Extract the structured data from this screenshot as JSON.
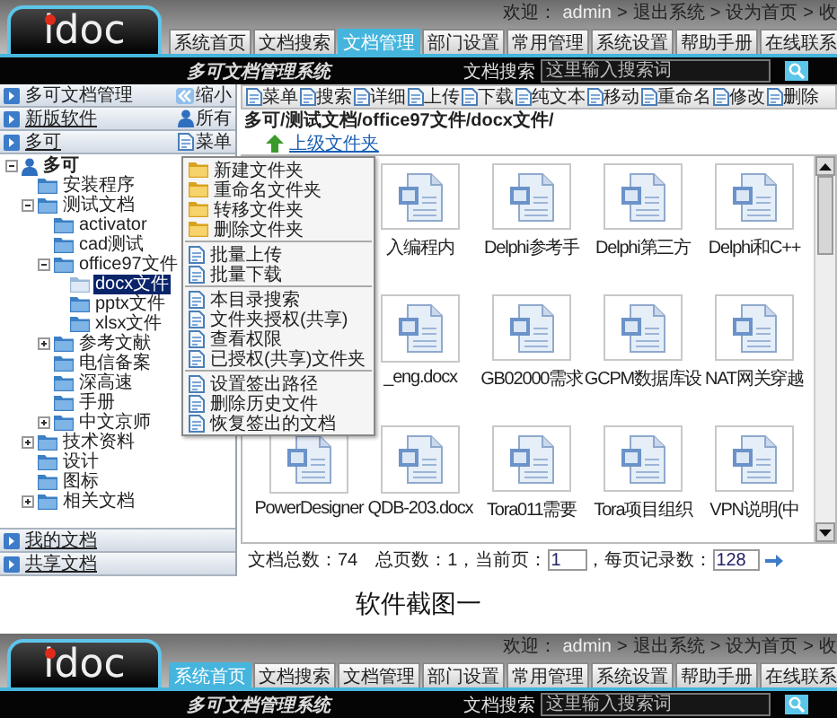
{
  "screenshot_1": {
    "header": {
      "logo": "idoc",
      "welcome": "欢迎：",
      "user": "admin",
      "links": [
        {
          "separator": ">",
          "label": "退出系统"
        },
        {
          "separator": ">",
          "label": "设为首页"
        },
        {
          "separator": ">",
          "label": "收"
        }
      ],
      "tabs": [
        {
          "label": "系统首页",
          "selected": false
        },
        {
          "label": "文档搜索",
          "selected": false
        },
        {
          "label": "文档管理",
          "selected": true
        },
        {
          "label": "部门设置",
          "selected": false
        },
        {
          "label": "常用管理",
          "selected": false
        },
        {
          "label": "系统设置",
          "selected": false
        },
        {
          "label": "帮助手册",
          "selected": false
        },
        {
          "label": "在线联系",
          "selected": false
        }
      ],
      "subtitle": "多可文档管理系统",
      "search": {
        "label": "文档搜索",
        "placeholder": "这里输入搜索词"
      }
    },
    "sidebar": {
      "panels": [
        {
          "label": "多可文档管理",
          "link": false,
          "button": "缩小"
        },
        {
          "label": "新版软件",
          "link": true,
          "button": "所有"
        },
        {
          "label": "多可",
          "link": true,
          "button": "菜单"
        }
      ],
      "tree": [
        {
          "label": "多可",
          "selected": false,
          "expanded": true,
          "children": [
            {
              "label": "安装程序",
              "selected": false
            },
            {
              "label": "测试文档",
              "selected": false,
              "expanded": true,
              "children": [
                {
                  "label": "activator",
                  "selected": false
                },
                {
                  "label": "cad测试",
                  "selected": false
                },
                {
                  "label": "office97文件",
                  "selected": false,
                  "expanded": true,
                  "children": [
                    {
                      "label": "docx文件",
                      "selected": true
                    },
                    {
                      "label": "pptx文件",
                      "selected": false
                    },
                    {
                      "label": "xlsx文件",
                      "selected": false
                    }
                  ]
                },
                {
                  "label": "参考文献",
                  "selected": false,
                  "expanded": false
                },
                {
                  "label": "电信备案",
                  "selected": false
                },
                {
                  "label": "深高速",
                  "selected": false
                },
                {
                  "label": "手册",
                  "selected": false
                },
                {
                  "label": "中文京师",
                  "selected": false,
                  "expanded": false
                }
              ]
            },
            {
              "label": "技术资料",
              "selected": false,
              "expanded": false
            },
            {
              "label": "设计",
              "selected": false
            },
            {
              "label": "图标",
              "selected": false
            },
            {
              "label": "相关文档",
              "selected": false,
              "expanded": false
            }
          ]
        }
      ],
      "bottom_panels": [
        {
          "label": "我的文档",
          "link": true
        },
        {
          "label": "共享文档",
          "link": true
        }
      ]
    },
    "menu": {
      "groups": [
        [
          "新建文件夹",
          "重命名文件夹",
          "转移文件夹",
          "删除文件夹"
        ],
        [
          "批量上传",
          "批量下载"
        ],
        [
          "本目录搜索",
          "文件夹授权(共享)",
          "查看权限",
          "已授权(共享)文件夹"
        ],
        [
          "设置签出路径",
          "删除历史文件",
          "恢复签出的文档"
        ]
      ]
    },
    "explorer": {
      "toolbar": [
        "菜单",
        "搜索",
        "详细",
        "上传",
        "下载",
        "纯文本",
        "移动",
        "重命名",
        "修改",
        "删除"
      ],
      "path": "多可/测试文档/office97文件/docx文件/",
      "up_link": "上级文件夹",
      "file_rows": [
        [
          "入编程内",
          "Delphi参考手",
          "Delphi第三方",
          "Delphi和C++"
        ],
        [
          "_eng.docx",
          "GB02000需求",
          "GCPM数据库设",
          "NAT网关穿越"
        ],
        [
          "PowerDesigner",
          "QDB-203.docx",
          "Tora011需要",
          "Tora项目组织",
          "VPN说明(中"
        ]
      ],
      "footer": {
        "total": "文档总数：74",
        "pages": "总页数：1，",
        "page_label": "当前页：",
        "page": "1",
        "per_page_label": "，每页记录数：",
        "per_page": "128"
      }
    }
  },
  "caption": "软件截图一",
  "screenshot_2": {
    "header": {
      "logo": "idoc",
      "welcome": "欢迎：",
      "user": "admin",
      "links": [
        {
          "separator": ">",
          "label": "退出系统"
        },
        {
          "separator": ">",
          "label": "设为首页"
        },
        {
          "separator": ">",
          "label": "收"
        }
      ],
      "tabs": [
        {
          "label": "系统首页",
          "selected": true
        },
        {
          "label": "文档搜索",
          "selected": false
        },
        {
          "label": "文档管理",
          "selected": false
        },
        {
          "label": "部门设置",
          "selected": false
        },
        {
          "label": "常用管理",
          "selected": false
        },
        {
          "label": "系统设置",
          "selected": false
        },
        {
          "label": "帮助手册",
          "selected": false
        },
        {
          "label": "在线联系",
          "selected": false
        }
      ],
      "subtitle": "多可文档管理系统",
      "search": {
        "label": "文档搜索",
        "placeholder": "这里输入搜索词"
      }
    }
  }
}
